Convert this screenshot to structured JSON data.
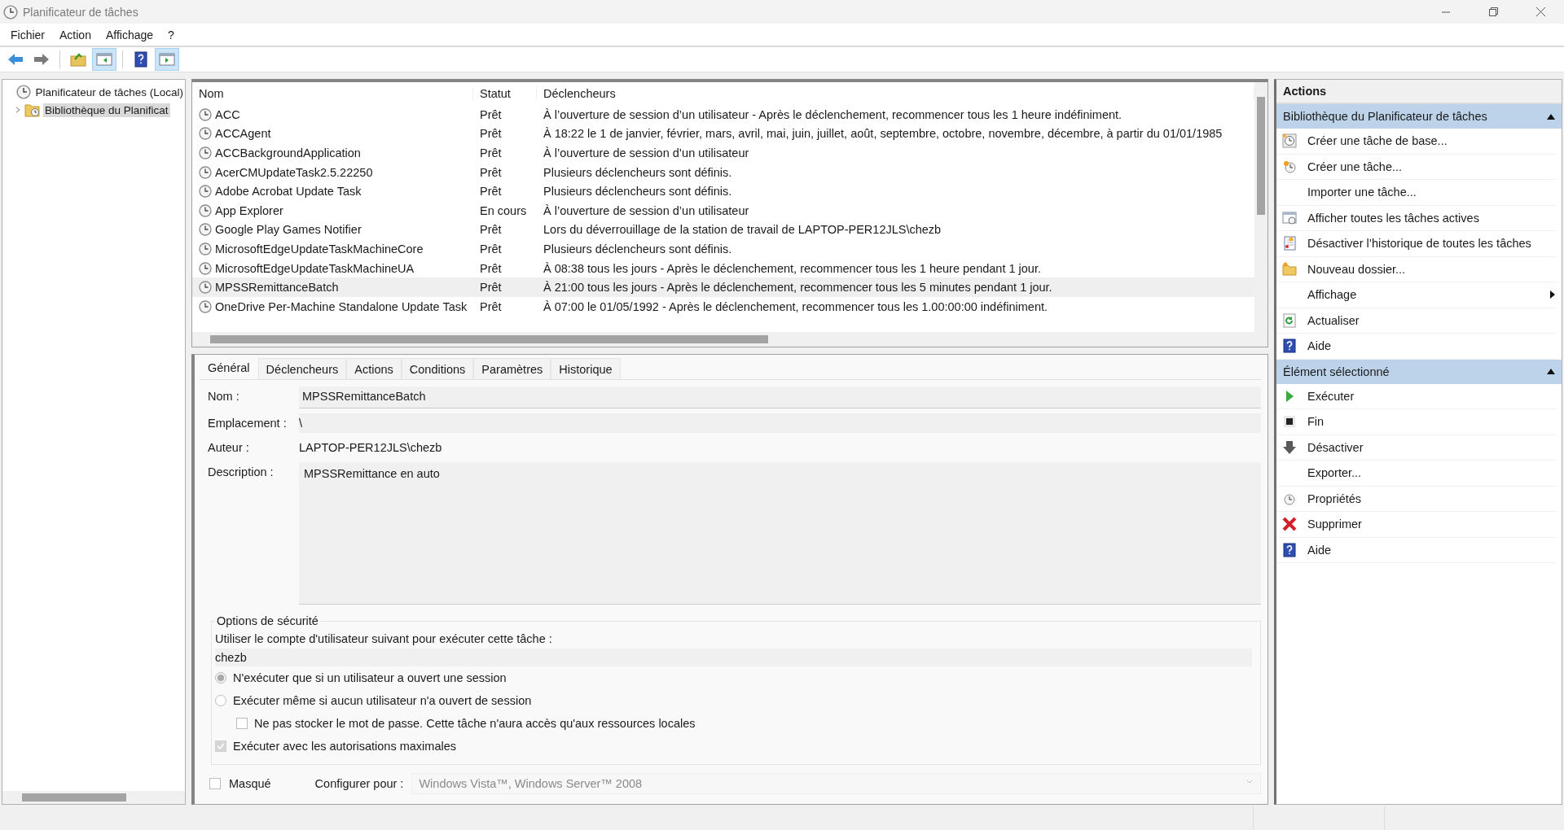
{
  "window": {
    "title": "Planificateur de tâches"
  },
  "menu": [
    "Fichier",
    "Action",
    "Affichage",
    "?"
  ],
  "toolbar": [
    {
      "kind": "back",
      "on": false
    },
    {
      "kind": "forward",
      "on": false
    },
    {
      "kind": "folder-up",
      "on": false
    },
    {
      "kind": "show-tree",
      "on": true
    },
    {
      "kind": "help",
      "on": false
    },
    {
      "kind": "show-actions",
      "on": true
    }
  ],
  "tree": [
    {
      "label": "Planificateur de tâches (Local)",
      "expanded": true,
      "selected": false,
      "children": [
        {
          "label": "Bibliothèque du Planificat",
          "expanded": false,
          "selected": true
        }
      ]
    }
  ],
  "table": {
    "columns": [
      "Nom",
      "Statut",
      "Déclencheurs"
    ],
    "rows": [
      {
        "name": "ACC",
        "status": "Prêt",
        "trigger": "À l’ouverture de session d’un utilisateur - Après le déclenchement, recommencer tous les 1 heure indéfiniment.",
        "selected": false
      },
      {
        "name": "ACCAgent",
        "status": "Prêt",
        "trigger": "À 18:22 le 1 de janvier, février, mars, avril, mai, juin, juillet, août, septembre, octobre, novembre, décembre, à partir du 01/01/1985",
        "selected": false
      },
      {
        "name": "ACCBackgroundApplication",
        "status": "Prêt",
        "trigger": "À l’ouverture de session d’un utilisateur",
        "selected": false
      },
      {
        "name": "AcerCMUpdateTask2.5.22250",
        "status": "Prêt",
        "trigger": "Plusieurs déclencheurs sont définis.",
        "selected": false
      },
      {
        "name": "Adobe Acrobat Update Task",
        "status": "Prêt",
        "trigger": "Plusieurs déclencheurs sont définis.",
        "selected": false
      },
      {
        "name": "App Explorer",
        "status": "En cours",
        "trigger": "À l’ouverture de session d’un utilisateur",
        "selected": false
      },
      {
        "name": "Google Play Games Notifier",
        "status": "Prêt",
        "trigger": "Lors du déverrouillage de la station de travail de LAPTOP-PER12JLS\\chezb",
        "selected": false
      },
      {
        "name": "MicrosoftEdgeUpdateTaskMachineCore",
        "status": "Prêt",
        "trigger": "Plusieurs déclencheurs sont définis.",
        "selected": false
      },
      {
        "name": "MicrosoftEdgeUpdateTaskMachineUA",
        "status": "Prêt",
        "trigger": "À 08:38 tous les jours - Après le déclenchement, recommencer tous les 1 heure pendant 1 jour.",
        "selected": false
      },
      {
        "name": "MPSSRemittanceBatch",
        "status": "Prêt",
        "trigger": "À 21:00 tous les jours - Après le déclenchement, recommencer tous les 5 minutes pendant 1 jour.",
        "selected": true
      },
      {
        "name": "OneDrive Per-Machine Standalone Update Task",
        "status": "Prêt",
        "trigger": "À 07:00 le 01/05/1992 - Après le déclenchement, recommencer tous les 1.00:00:00 indéfiniment.",
        "selected": false
      }
    ]
  },
  "tabs": [
    {
      "label": "Général",
      "selected": true
    },
    {
      "label": "Déclencheurs",
      "selected": false
    },
    {
      "label": "Actions",
      "selected": false
    },
    {
      "label": "Conditions",
      "selected": false
    },
    {
      "label": "Paramètres",
      "selected": false
    },
    {
      "label": "Historique",
      "selected": false
    }
  ],
  "general": {
    "name_label": "Nom :",
    "name": "MPSSRemittanceBatch",
    "location_label": "Emplacement :",
    "location": "\\",
    "author_label": "Auteur :",
    "author": "LAPTOP-PER12JLS\\chezb",
    "description_label": "Description :",
    "description": "MPSSRemittance en auto",
    "security": {
      "legend": "Options de sécurité",
      "account_prompt": "Utiliser le compte d'utilisateur suivant pour exécuter cette tâche :",
      "account": "chezb",
      "options": [
        {
          "kind": "radio",
          "label": "N'exécuter que si un utilisateur a ouvert une session",
          "checked": true,
          "disabled": true,
          "indented": false
        },
        {
          "kind": "radio",
          "label": "Exécuter même si aucun utilisateur n'a ouvert de session",
          "checked": false,
          "disabled": false,
          "indented": false
        },
        {
          "kind": "checkbox",
          "label": "Ne pas stocker le mot de passe. Cette tâche n'aura accès qu'aux ressources locales",
          "checked": false,
          "disabled": false,
          "indented": true
        },
        {
          "kind": "checkbox",
          "label": "Exécuter avec les autorisations maximales",
          "checked": true,
          "disabled": true,
          "indented": false
        }
      ]
    },
    "hidden": {
      "label": "Masqué",
      "checked": false
    },
    "configure_label": "Configurer pour :",
    "configure_value": "Windows Vista™, Windows Server™ 2008"
  },
  "actions": {
    "title": "Actions",
    "sections": [
      {
        "title": "Bibliothèque du Planificateur de tâches",
        "expanded": true,
        "items": [
          {
            "label": "Créer une tâche de base...",
            "kind": "wizard",
            "submenu": false
          },
          {
            "label": "Créer une tâche...",
            "kind": "new-task",
            "submenu": false
          },
          {
            "label": "Importer une tâche...",
            "kind": "plain",
            "submenu": false
          },
          {
            "label": "Afficher toutes les tâches actives",
            "kind": "running",
            "submenu": false
          },
          {
            "label": "Désactiver l’historique de toutes les tâches",
            "kind": "history",
            "submenu": false
          },
          {
            "label": "Nouveau dossier...",
            "kind": "folder",
            "submenu": false
          },
          {
            "label": "Affichage",
            "kind": "plain",
            "submenu": true
          },
          {
            "label": "Actualiser",
            "kind": "refresh",
            "submenu": false
          },
          {
            "label": "Aide",
            "kind": "help",
            "submenu": false
          }
        ]
      },
      {
        "title": "Élément sélectionné",
        "expanded": true,
        "items": [
          {
            "label": "Exécuter",
            "kind": "run",
            "submenu": false
          },
          {
            "label": "Fin",
            "kind": "stop",
            "submenu": false
          },
          {
            "label": "Désactiver",
            "kind": "disable",
            "submenu": false
          },
          {
            "label": "Exporter...",
            "kind": "plain",
            "submenu": false
          },
          {
            "label": "Propriétés",
            "kind": "properties",
            "submenu": false
          },
          {
            "label": "Supprimer",
            "kind": "delete",
            "submenu": false
          },
          {
            "label": "Aide",
            "kind": "help",
            "submenu": false
          }
        ]
      }
    ]
  }
}
